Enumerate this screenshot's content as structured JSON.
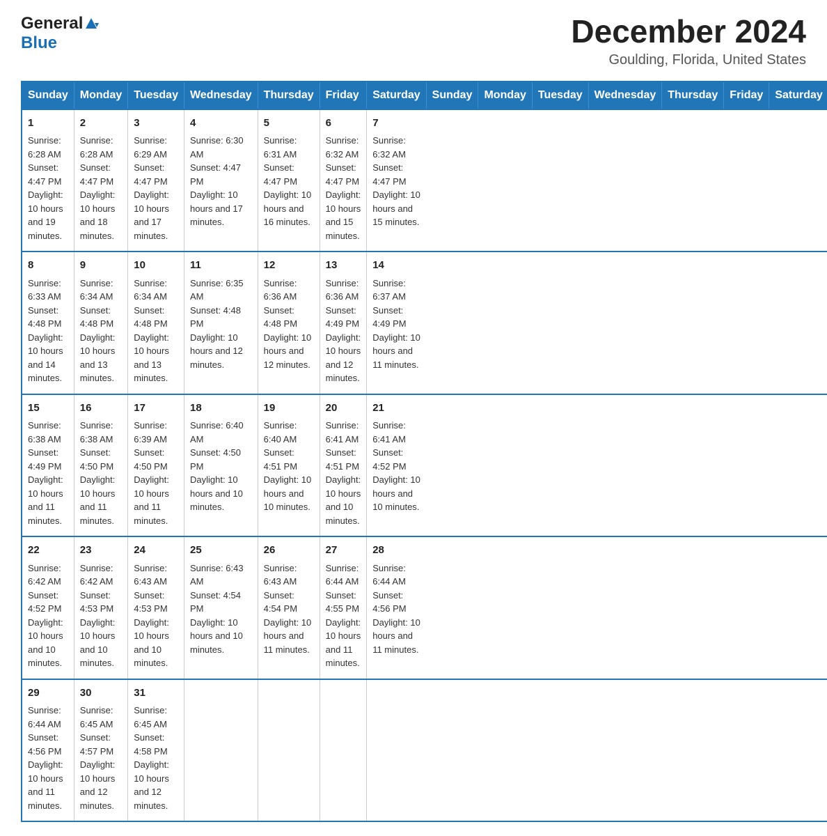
{
  "header": {
    "title": "December 2024",
    "location": "Goulding, Florida, United States",
    "logo_general": "General",
    "logo_blue": "Blue"
  },
  "days_of_week": [
    "Sunday",
    "Monday",
    "Tuesday",
    "Wednesday",
    "Thursday",
    "Friday",
    "Saturday"
  ],
  "weeks": [
    [
      {
        "day": "1",
        "sunrise": "6:28 AM",
        "sunset": "4:47 PM",
        "daylight": "10 hours and 19 minutes."
      },
      {
        "day": "2",
        "sunrise": "6:28 AM",
        "sunset": "4:47 PM",
        "daylight": "10 hours and 18 minutes."
      },
      {
        "day": "3",
        "sunrise": "6:29 AM",
        "sunset": "4:47 PM",
        "daylight": "10 hours and 17 minutes."
      },
      {
        "day": "4",
        "sunrise": "6:30 AM",
        "sunset": "4:47 PM",
        "daylight": "10 hours and 17 minutes."
      },
      {
        "day": "5",
        "sunrise": "6:31 AM",
        "sunset": "4:47 PM",
        "daylight": "10 hours and 16 minutes."
      },
      {
        "day": "6",
        "sunrise": "6:32 AM",
        "sunset": "4:47 PM",
        "daylight": "10 hours and 15 minutes."
      },
      {
        "day": "7",
        "sunrise": "6:32 AM",
        "sunset": "4:47 PM",
        "daylight": "10 hours and 15 minutes."
      }
    ],
    [
      {
        "day": "8",
        "sunrise": "6:33 AM",
        "sunset": "4:48 PM",
        "daylight": "10 hours and 14 minutes."
      },
      {
        "day": "9",
        "sunrise": "6:34 AM",
        "sunset": "4:48 PM",
        "daylight": "10 hours and 13 minutes."
      },
      {
        "day": "10",
        "sunrise": "6:34 AM",
        "sunset": "4:48 PM",
        "daylight": "10 hours and 13 minutes."
      },
      {
        "day": "11",
        "sunrise": "6:35 AM",
        "sunset": "4:48 PM",
        "daylight": "10 hours and 12 minutes."
      },
      {
        "day": "12",
        "sunrise": "6:36 AM",
        "sunset": "4:48 PM",
        "daylight": "10 hours and 12 minutes."
      },
      {
        "day": "13",
        "sunrise": "6:36 AM",
        "sunset": "4:49 PM",
        "daylight": "10 hours and 12 minutes."
      },
      {
        "day": "14",
        "sunrise": "6:37 AM",
        "sunset": "4:49 PM",
        "daylight": "10 hours and 11 minutes."
      }
    ],
    [
      {
        "day": "15",
        "sunrise": "6:38 AM",
        "sunset": "4:49 PM",
        "daylight": "10 hours and 11 minutes."
      },
      {
        "day": "16",
        "sunrise": "6:38 AM",
        "sunset": "4:50 PM",
        "daylight": "10 hours and 11 minutes."
      },
      {
        "day": "17",
        "sunrise": "6:39 AM",
        "sunset": "4:50 PM",
        "daylight": "10 hours and 11 minutes."
      },
      {
        "day": "18",
        "sunrise": "6:40 AM",
        "sunset": "4:50 PM",
        "daylight": "10 hours and 10 minutes."
      },
      {
        "day": "19",
        "sunrise": "6:40 AM",
        "sunset": "4:51 PM",
        "daylight": "10 hours and 10 minutes."
      },
      {
        "day": "20",
        "sunrise": "6:41 AM",
        "sunset": "4:51 PM",
        "daylight": "10 hours and 10 minutes."
      },
      {
        "day": "21",
        "sunrise": "6:41 AM",
        "sunset": "4:52 PM",
        "daylight": "10 hours and 10 minutes."
      }
    ],
    [
      {
        "day": "22",
        "sunrise": "6:42 AM",
        "sunset": "4:52 PM",
        "daylight": "10 hours and 10 minutes."
      },
      {
        "day": "23",
        "sunrise": "6:42 AM",
        "sunset": "4:53 PM",
        "daylight": "10 hours and 10 minutes."
      },
      {
        "day": "24",
        "sunrise": "6:43 AM",
        "sunset": "4:53 PM",
        "daylight": "10 hours and 10 minutes."
      },
      {
        "day": "25",
        "sunrise": "6:43 AM",
        "sunset": "4:54 PM",
        "daylight": "10 hours and 10 minutes."
      },
      {
        "day": "26",
        "sunrise": "6:43 AM",
        "sunset": "4:54 PM",
        "daylight": "10 hours and 11 minutes."
      },
      {
        "day": "27",
        "sunrise": "6:44 AM",
        "sunset": "4:55 PM",
        "daylight": "10 hours and 11 minutes."
      },
      {
        "day": "28",
        "sunrise": "6:44 AM",
        "sunset": "4:56 PM",
        "daylight": "10 hours and 11 minutes."
      }
    ],
    [
      {
        "day": "29",
        "sunrise": "6:44 AM",
        "sunset": "4:56 PM",
        "daylight": "10 hours and 11 minutes."
      },
      {
        "day": "30",
        "sunrise": "6:45 AM",
        "sunset": "4:57 PM",
        "daylight": "10 hours and 12 minutes."
      },
      {
        "day": "31",
        "sunrise": "6:45 AM",
        "sunset": "4:58 PM",
        "daylight": "10 hours and 12 minutes."
      },
      {
        "day": "",
        "sunrise": "",
        "sunset": "",
        "daylight": ""
      },
      {
        "day": "",
        "sunrise": "",
        "sunset": "",
        "daylight": ""
      },
      {
        "day": "",
        "sunrise": "",
        "sunset": "",
        "daylight": ""
      },
      {
        "day": "",
        "sunrise": "",
        "sunset": "",
        "daylight": ""
      }
    ]
  ],
  "labels": {
    "sunrise": "Sunrise:",
    "sunset": "Sunset:",
    "daylight": "Daylight:"
  }
}
